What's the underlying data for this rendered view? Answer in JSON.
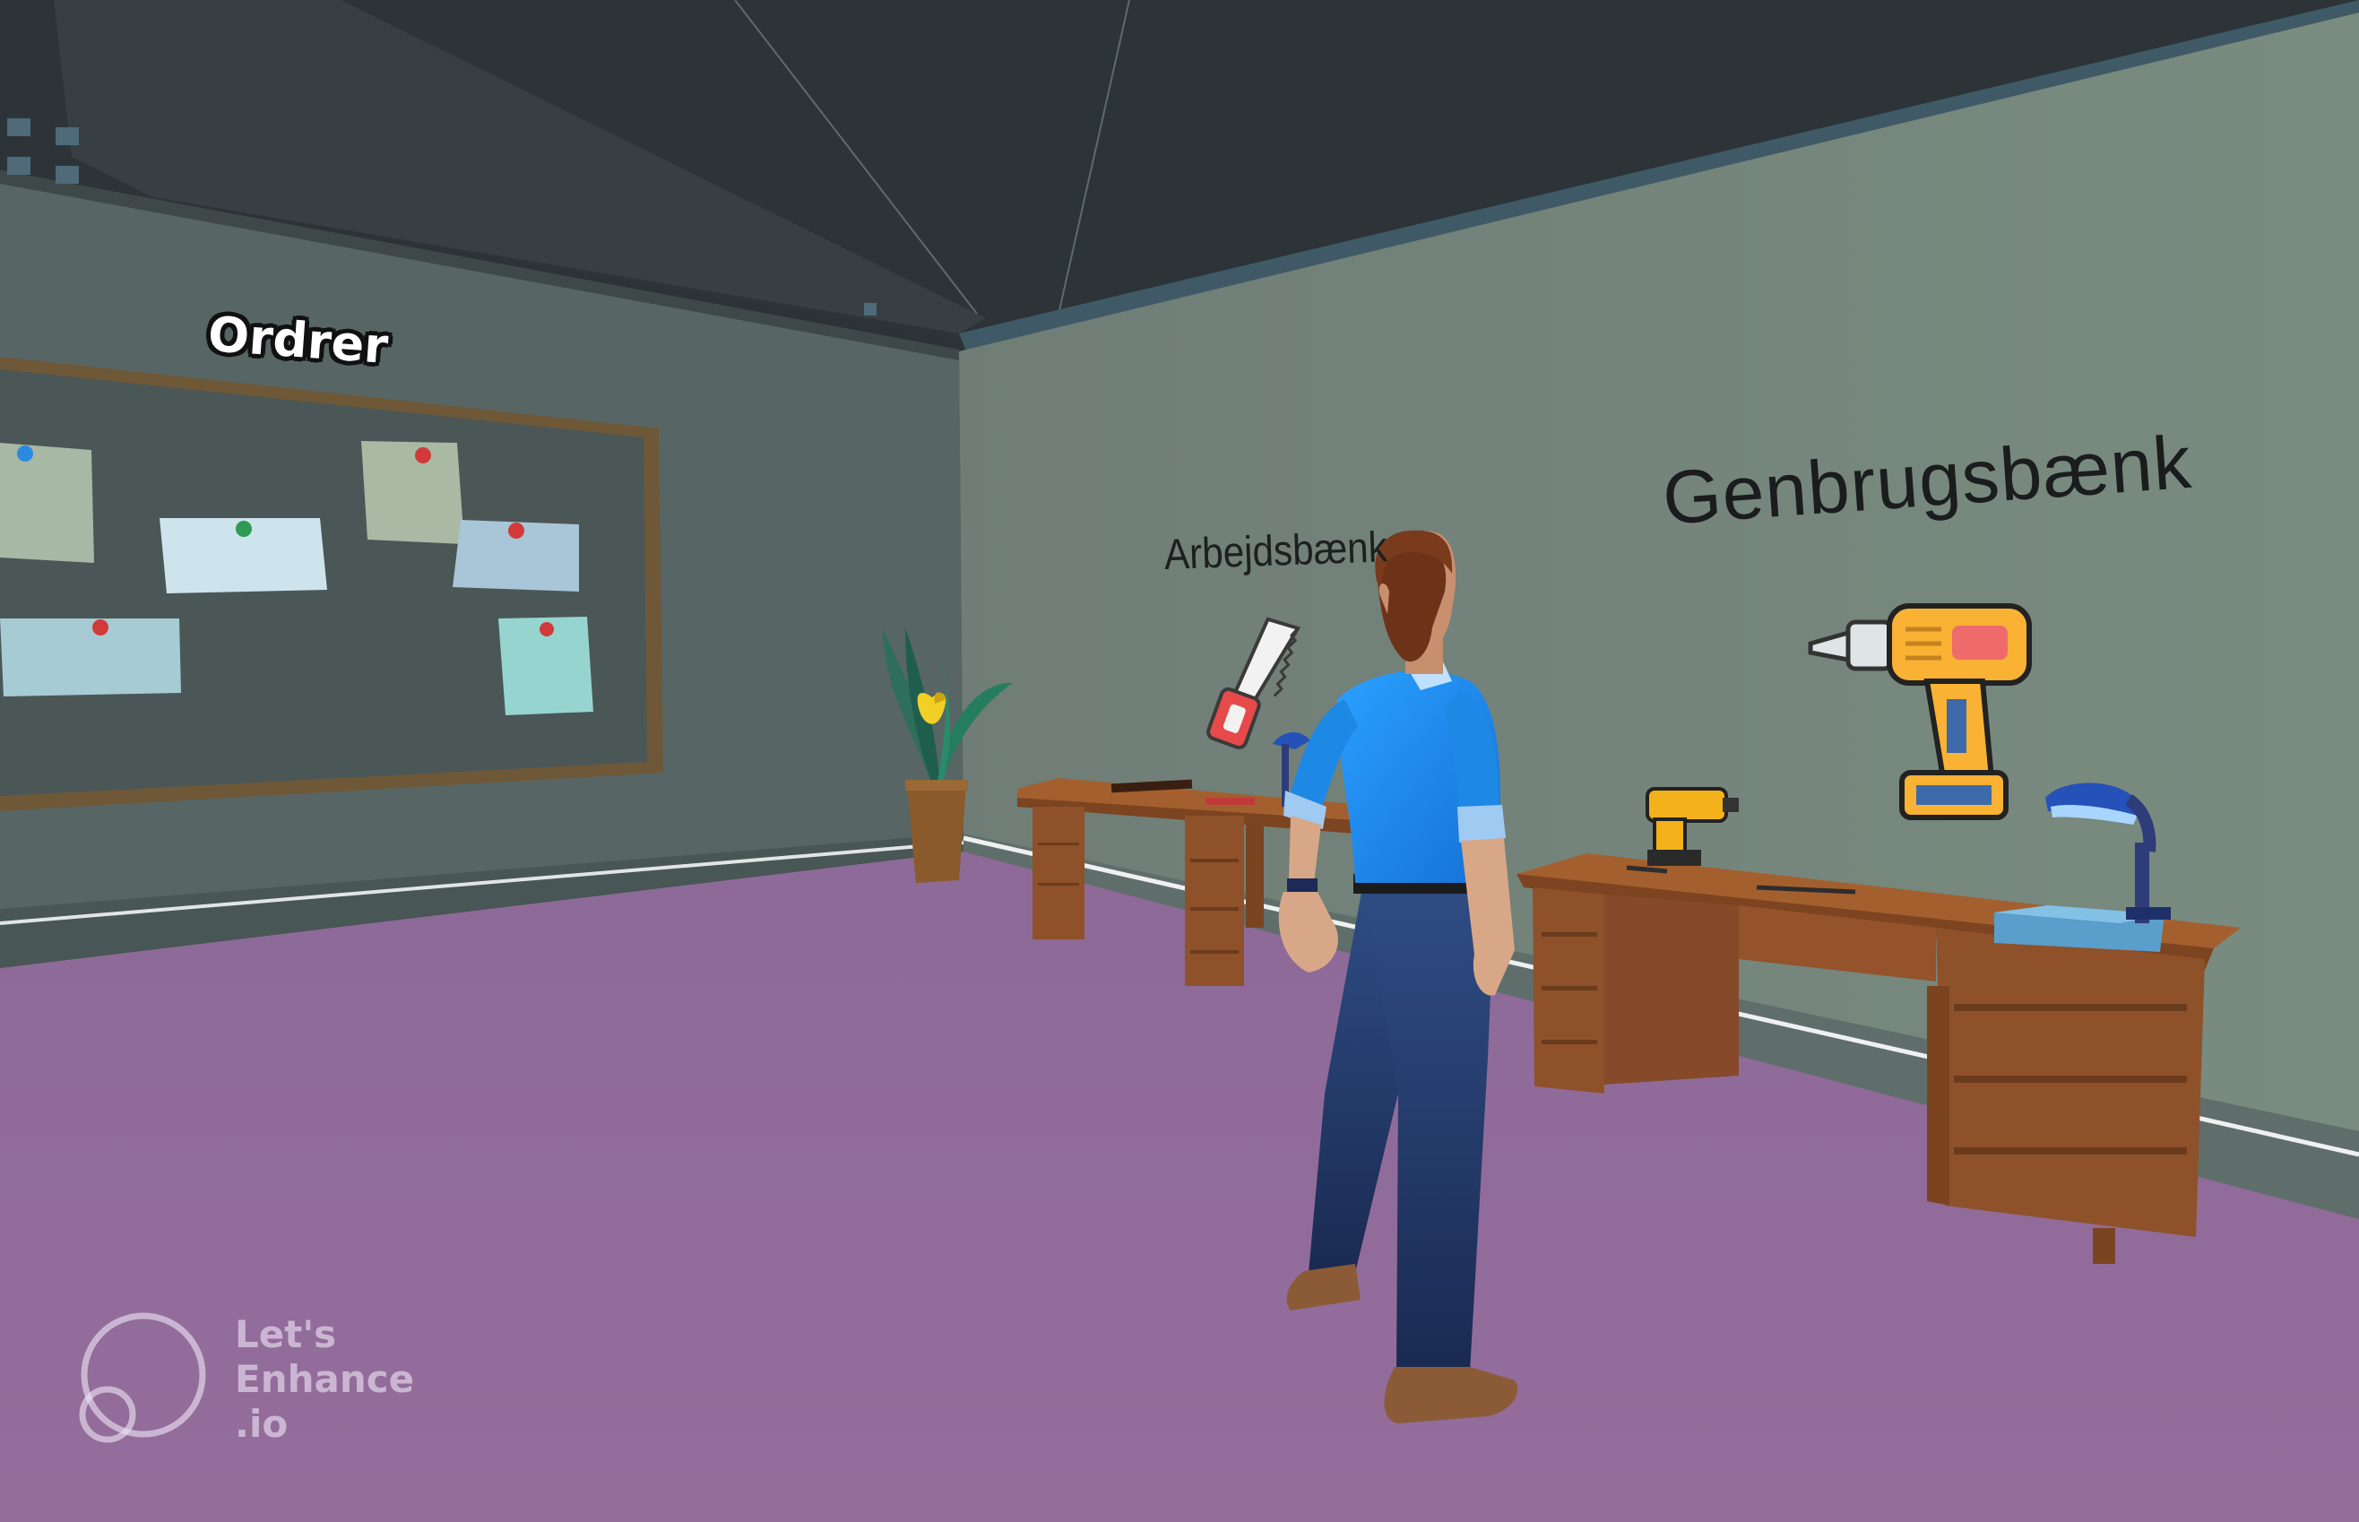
{
  "scene": {
    "board_sign": "Ordrer",
    "workbench_sign": "Arbejdsbænk",
    "recycle_sign": "Genbrugsbænk"
  },
  "watermark": {
    "line1": "Let's",
    "line2": "Enhance",
    "line3": ".io"
  },
  "colors": {
    "floor": "#936c9b",
    "back_wall": "#76877c",
    "left_wall": "#566464",
    "ceiling": "#2d3538",
    "board": "#4c5757",
    "board_frame": "#6e5838",
    "desk_wood": "#96592f",
    "shirt": "#1e88e5",
    "pants": "#233a66"
  },
  "icons": [
    "saw-icon",
    "power-drill-icon",
    "plant-pot",
    "desk-lamp",
    "watermark-logo-icon"
  ]
}
